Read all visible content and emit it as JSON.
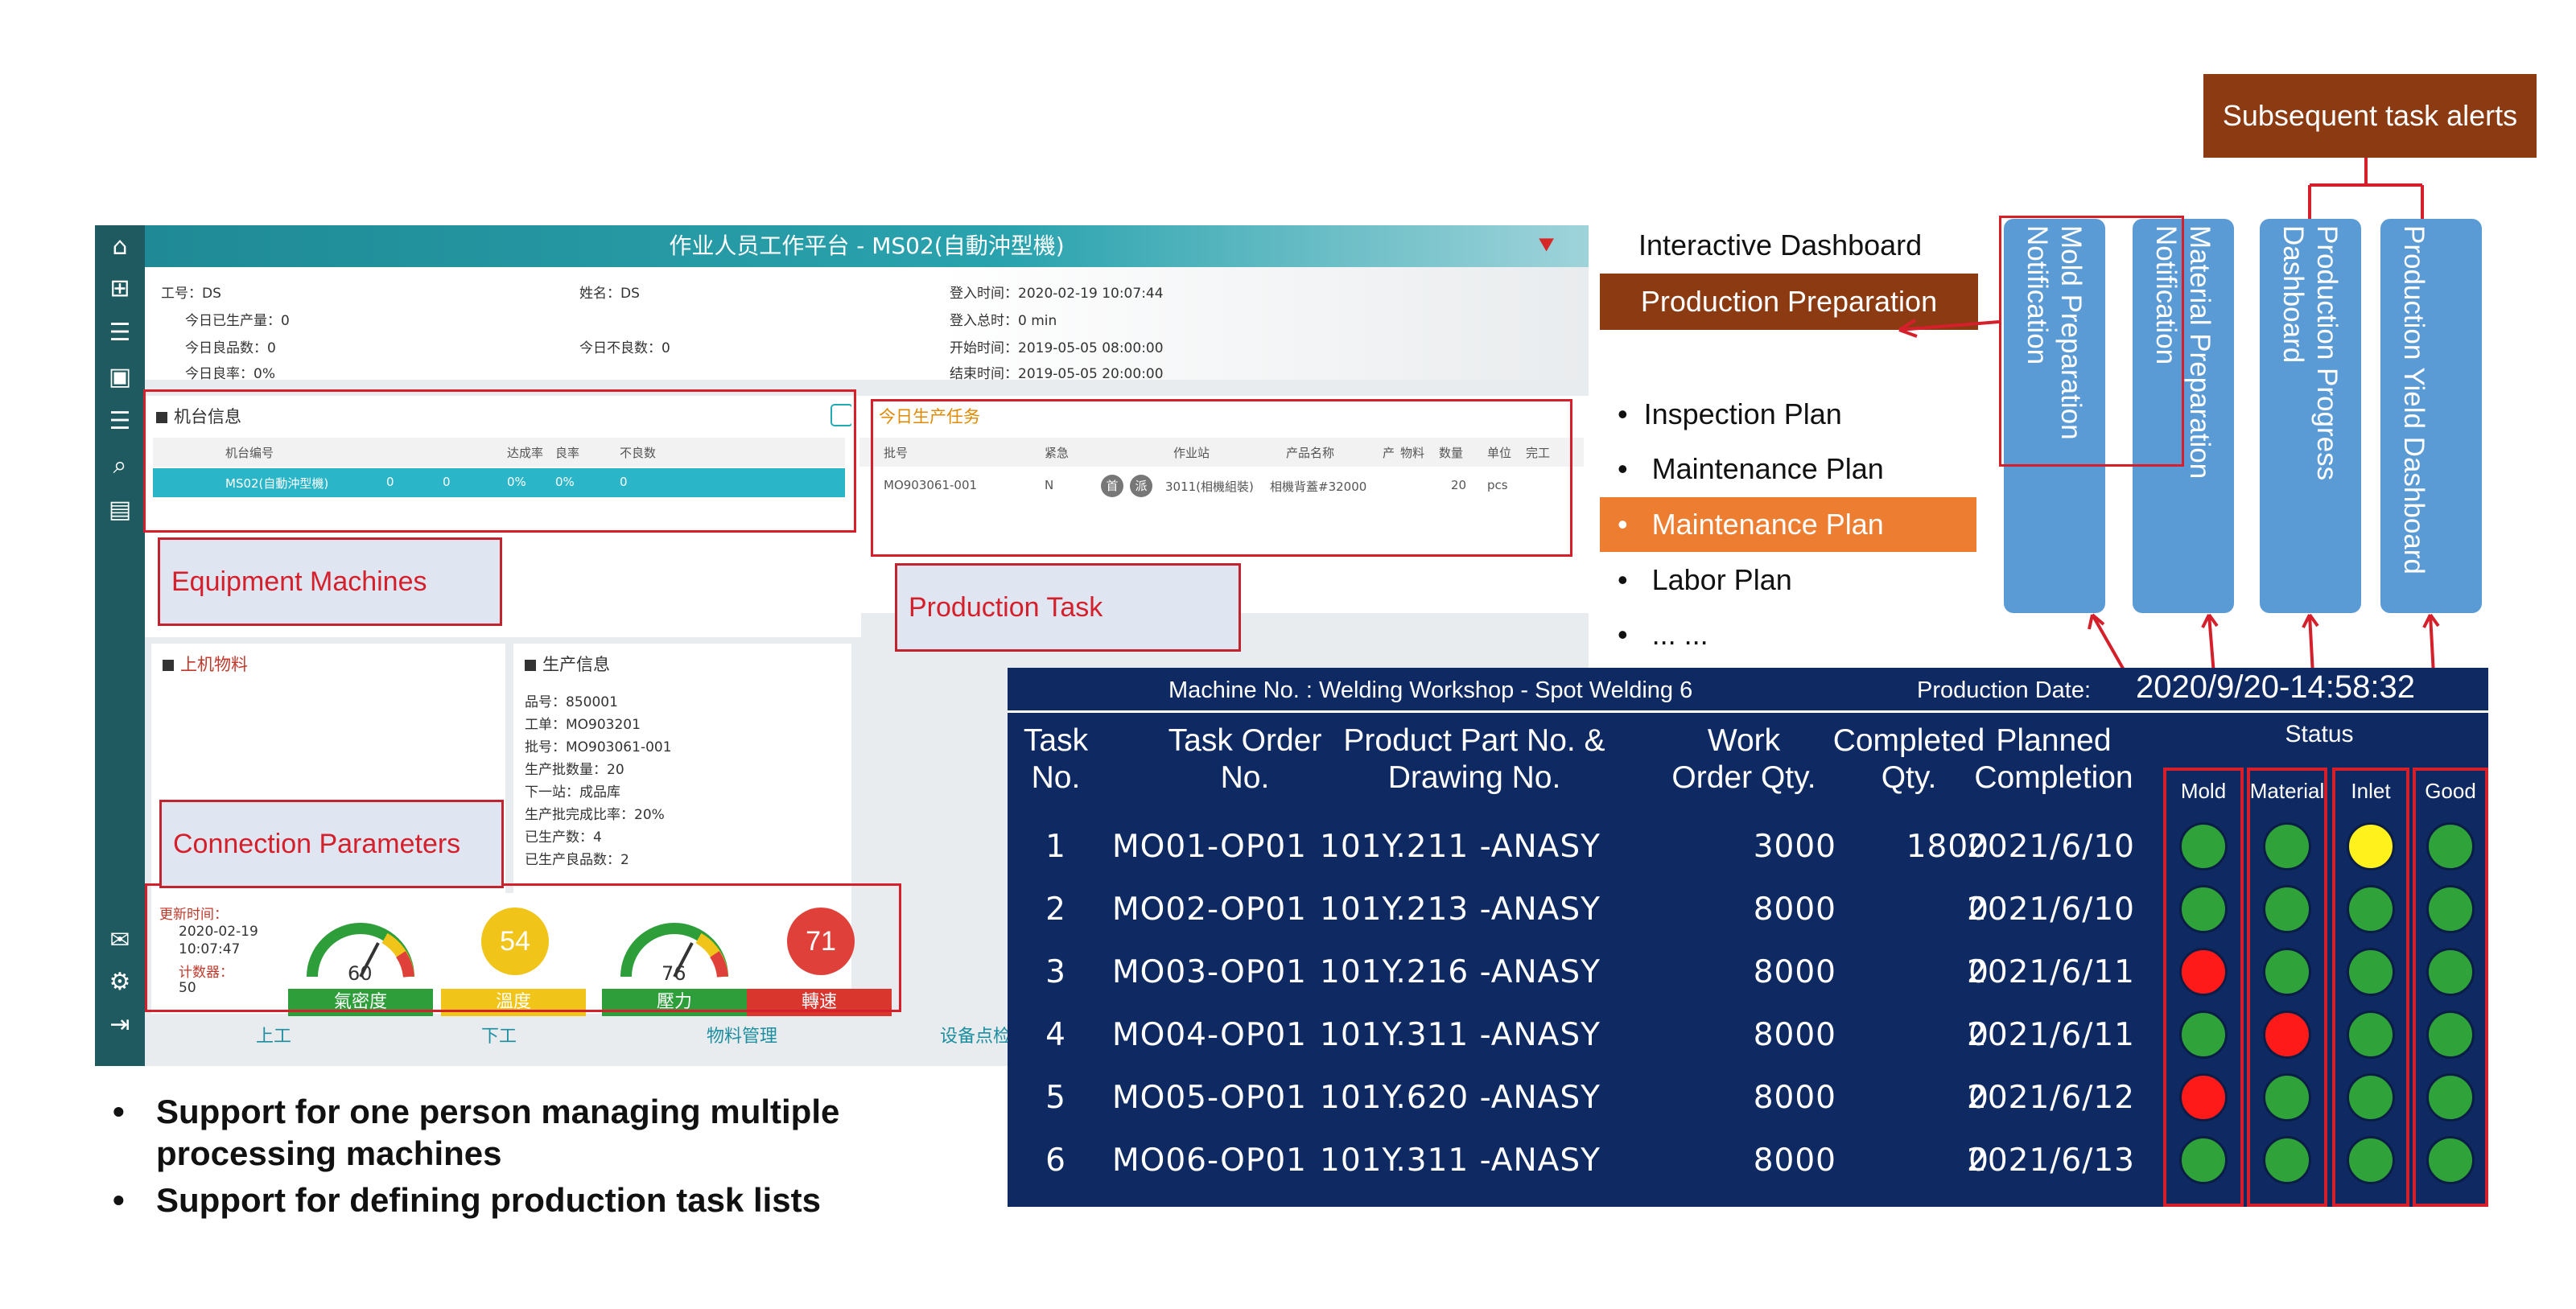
{
  "app": {
    "title": "作业人员工作平台 - MS02(自動沖型機)",
    "info": {
      "worker_label": "工号：DS",
      "name_label": "姓名：DS",
      "login_time": "登入时间：2020-02-19 10:07:44",
      "produced_today": "今日已生产量：0",
      "login_total": "登入总时：0 min",
      "good_today": "今日良品数：0",
      "bad_today": "今日不良数：0",
      "start_time": "开始时间：2019-05-05 08:00:00",
      "yield_today": "今日良率：0%",
      "end_time": "结束时间：2019-05-05 20:00:00"
    },
    "machine_panel": {
      "title": "机台信息",
      "cols": [
        "机台编号",
        "达成率",
        "良率",
        "不良数"
      ],
      "row": {
        "id": "MS02(自動沖型機)",
        "a": "0",
        "b": "0",
        "rate": "0%",
        "yield": "0%",
        "bad": "0"
      }
    },
    "task_panel": {
      "title": "今日生产任务",
      "cols": [
        "批号",
        "紧急",
        "作业站",
        "产品名称",
        "产",
        "物料",
        "数量",
        "单位",
        "完工"
      ],
      "row": {
        "lot": "MO903061-001",
        "urgent": "N",
        "station": "3011(相機組裝)",
        "product": "相機背蓋#32000",
        "qty": "20",
        "unit": "pcs",
        "tag1": "首",
        "tag2": "派"
      }
    },
    "material_panel": {
      "title": "上机物料"
    },
    "prod_panel": {
      "title": "生产信息",
      "lines": [
        "品号：850001",
        "工单：MO903201",
        "批号：MO903061-001",
        "生产批数量：20",
        "下一站：成品库",
        "生产批完成比率：20%",
        "已生产数：4",
        "已生产良品数：2"
      ]
    },
    "params": {
      "update_label": "更新时间：",
      "update_time": "2020-02-19",
      "update_clock": "10:07:47",
      "counter_label": "计数器：",
      "counter": "50",
      "gauges": [
        {
          "label": "氣密度",
          "value": "60",
          "min": "5",
          "mid": "50",
          "max": "100",
          "color": "#2e9e3a"
        },
        {
          "label": "溫度",
          "value": "54",
          "color": "#f0c419"
        },
        {
          "label": "壓力",
          "value": "76",
          "min": "",
          "mid": "70",
          "max": "90",
          "color": "#2e9e3a"
        },
        {
          "label": "轉速",
          "value": "71",
          "color": "#e0403a"
        }
      ]
    },
    "bottom_tabs": [
      "上工",
      "下工",
      "物料管理",
      "设备点检"
    ]
  },
  "callouts": {
    "equipment": "Equipment Machines",
    "task": "Production Task",
    "params": "Connection Parameters"
  },
  "bullets": [
    "Support for one person managing multiple processing machines",
    "Support for defining production task lists"
  ],
  "right": {
    "interactive": "Interactive Dashboard",
    "prep": "Production Preparation",
    "plans": [
      "Inspection Plan",
      "Maintenance Plan",
      "Maintenance Plan",
      "Labor Plan",
      "... ..."
    ],
    "alerts": "Subsequent task alerts",
    "pills": [
      "Mold Preparation\nNotification",
      "Material Preparation\nNotification",
      "Production Progress\nDashboard",
      "Production Yield Dashboard"
    ]
  },
  "dashboard": {
    "machine": "Machine No. : Welding Workshop - Spot Welding 6",
    "date_label": "Production Date:",
    "datetime": "2020/9/20-14:58:32",
    "headers": [
      "Task\nNo.",
      "Task Order\nNo.",
      "Product Part No. &\nDrawing No.",
      "Work\nOrder Qty.",
      "Completed\nQty.",
      "Planned\nCompletion"
    ],
    "status_label": "Status",
    "status_cols": [
      "Mold",
      "Material",
      "Inlet",
      "Good"
    ],
    "rows": [
      {
        "no": "1",
        "order": "MO01-OP01",
        "part": "101Y.211 -ANASY",
        "qty": "3000",
        "done": "1800",
        "date": "2021/6/10",
        "lights": [
          "green",
          "green",
          "yellow",
          "green"
        ]
      },
      {
        "no": "2",
        "order": "MO02-OP01",
        "part": "101Y.213 -ANASY",
        "qty": "8000",
        "done": "0",
        "date": "2021/6/10",
        "lights": [
          "green",
          "green",
          "green",
          "green"
        ]
      },
      {
        "no": "3",
        "order": "MO03-OP01",
        "part": "101Y.216 -ANASY",
        "qty": "8000",
        "done": "0",
        "date": "2021/6/11",
        "lights": [
          "red",
          "green",
          "green",
          "green"
        ]
      },
      {
        "no": "4",
        "order": "MO04-OP01",
        "part": "101Y.311 -ANASY",
        "qty": "8000",
        "done": "0",
        "date": "2021/6/11",
        "lights": [
          "green",
          "red",
          "green",
          "green"
        ]
      },
      {
        "no": "5",
        "order": "MO05-OP01",
        "part": "101Y.620 -ANASY",
        "qty": "8000",
        "done": "0",
        "date": "2021/6/12",
        "lights": [
          "red",
          "green",
          "green",
          "green"
        ]
      },
      {
        "no": "6",
        "order": "MO06-OP01",
        "part": "101Y.311 -ANASY",
        "qty": "8000",
        "done": "0",
        "date": "2021/6/13",
        "lights": [
          "green",
          "green",
          "green",
          "green"
        ]
      }
    ]
  },
  "colors": {
    "green": "#2fa33a",
    "red": "#ff1a1a",
    "yellow": "#fff21c",
    "brown": "#8b3a12",
    "orange": "#ed7d31",
    "pill": "#5b9bd5",
    "navy": "#0f2a63"
  }
}
